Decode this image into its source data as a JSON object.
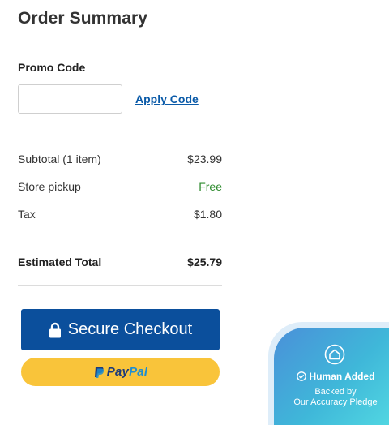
{
  "summary": {
    "title": "Order Summary",
    "promo": {
      "label": "Promo Code",
      "input_value": "",
      "apply_label": "Apply Code"
    },
    "lines": [
      {
        "label": "Subtotal (1 item)",
        "value": "$23.99"
      },
      {
        "label": "Store pickup",
        "value": "Free"
      },
      {
        "label": "Tax",
        "value": "$1.80"
      }
    ],
    "total": {
      "label": "Estimated Total",
      "value": "$25.79"
    }
  },
  "actions": {
    "checkout_label": "Secure Checkout",
    "paypal_pay": "Pay",
    "paypal_pal": "Pal"
  },
  "badge": {
    "title": "Human Added",
    "line1": "Backed by",
    "line2": "Our Accuracy Pledge"
  },
  "colors": {
    "checkout_bg": "#0b4f9c",
    "paypal_bg": "#f9c43a",
    "link": "#0a5aa8",
    "free_text": "#2e8b2e",
    "badge_gradient_start": "#4a90d9",
    "badge_gradient_end": "#52d8e2"
  },
  "icons": {
    "checkout": "lock-icon",
    "paypal": "paypal-logo-icon",
    "badge_top": "house-icon",
    "badge_title": "check-circle-icon"
  }
}
